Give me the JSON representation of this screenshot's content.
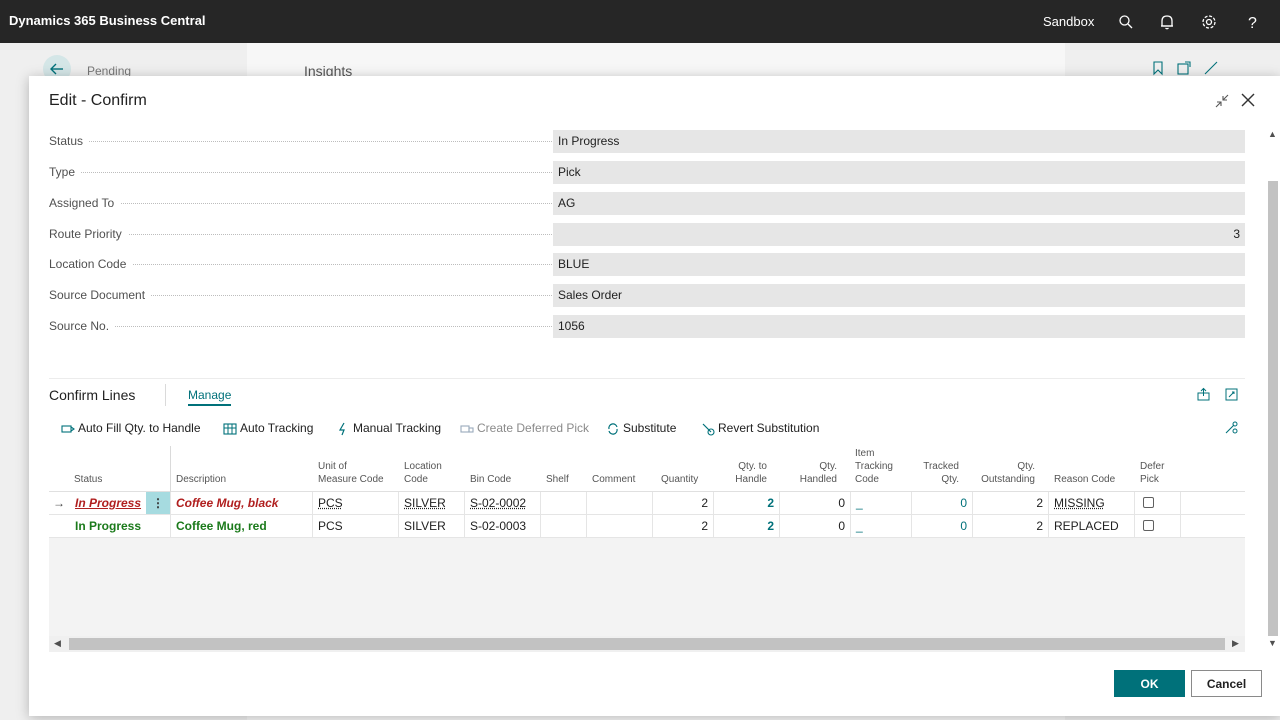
{
  "app": {
    "title": "Dynamics 365 Business Central",
    "environment": "Sandbox"
  },
  "background": {
    "pending_label": "Pending",
    "insights_label": "Insights"
  },
  "dialog": {
    "title": "Edit - Confirm",
    "fields": [
      {
        "label": "Status",
        "value": "In Progress"
      },
      {
        "label": "Type",
        "value": "Pick"
      },
      {
        "label": "Assigned To",
        "value": "AG"
      },
      {
        "label": "Route Priority",
        "value": "3"
      },
      {
        "label": "Location Code",
        "value": "BLUE"
      },
      {
        "label": "Source Document",
        "value": "Sales Order"
      },
      {
        "label": "Source No.",
        "value": "1056"
      }
    ],
    "ok_label": "OK",
    "cancel_label": "Cancel"
  },
  "lines": {
    "title": "Confirm Lines",
    "tab_manage": "Manage",
    "actions": [
      {
        "label": "Auto Fill Qty. to Handle",
        "icon": "auto-fill-icon",
        "enabled": true
      },
      {
        "label": "Auto Tracking",
        "icon": "auto-tracking-icon",
        "enabled": true
      },
      {
        "label": "Manual Tracking",
        "icon": "manual-tracking-icon",
        "enabled": true
      },
      {
        "label": "Create Deferred Pick",
        "icon": "deferred-pick-icon",
        "enabled": false
      },
      {
        "label": "Substitute",
        "icon": "substitute-icon",
        "enabled": true
      },
      {
        "label": "Revert Substitution",
        "icon": "revert-substitution-icon",
        "enabled": true
      }
    ],
    "columns": {
      "status": "Status",
      "description": "Description",
      "uom_1": "Unit of",
      "uom_2": "Measure Code",
      "loc_1": "Location",
      "loc_2": "Code",
      "bin": "Bin Code",
      "shelf": "Shelf",
      "comment": "Comment",
      "quantity": "Quantity",
      "qth_1": "Qty. to",
      "qth_2": "Handle",
      "qh_1": "Qty.",
      "qh_2": "Handled",
      "itc_1": "Item",
      "itc_2": "Tracking",
      "itc_3": "Code",
      "tq_1": "Tracked",
      "tq_2": "Qty.",
      "qo_1": "Qty.",
      "qo_2": "Outstanding",
      "reason": "Reason Code",
      "dp_1": "Defer",
      "dp_2": "Pick"
    },
    "rows": [
      {
        "status": "In Progress",
        "description": "Coffee Mug, black",
        "uom": "PCS",
        "location": "SILVER",
        "bin": "S-02-0002",
        "shelf": "",
        "comment": "",
        "quantity": "2",
        "qty_to_handle": "2",
        "qty_handled": "0",
        "item_tracking": "_",
        "tracked_qty": "0",
        "qty_outstanding": "2",
        "reason_code": "MISSING",
        "defer_pick": false
      },
      {
        "status": "In Progress",
        "description": "Coffee Mug, red",
        "uom": "PCS",
        "location": "SILVER",
        "bin": "S-02-0003",
        "shelf": "",
        "comment": "",
        "quantity": "2",
        "qty_to_handle": "2",
        "qty_handled": "0",
        "item_tracking": "_",
        "tracked_qty": "0",
        "qty_outstanding": "2",
        "reason_code": "REPLACED",
        "defer_pick": false
      }
    ]
  },
  "colors": {
    "accent": "#00717a",
    "topbar": "#262626",
    "status_red": "#b01f1f",
    "status_green": "#1b7a1b"
  }
}
